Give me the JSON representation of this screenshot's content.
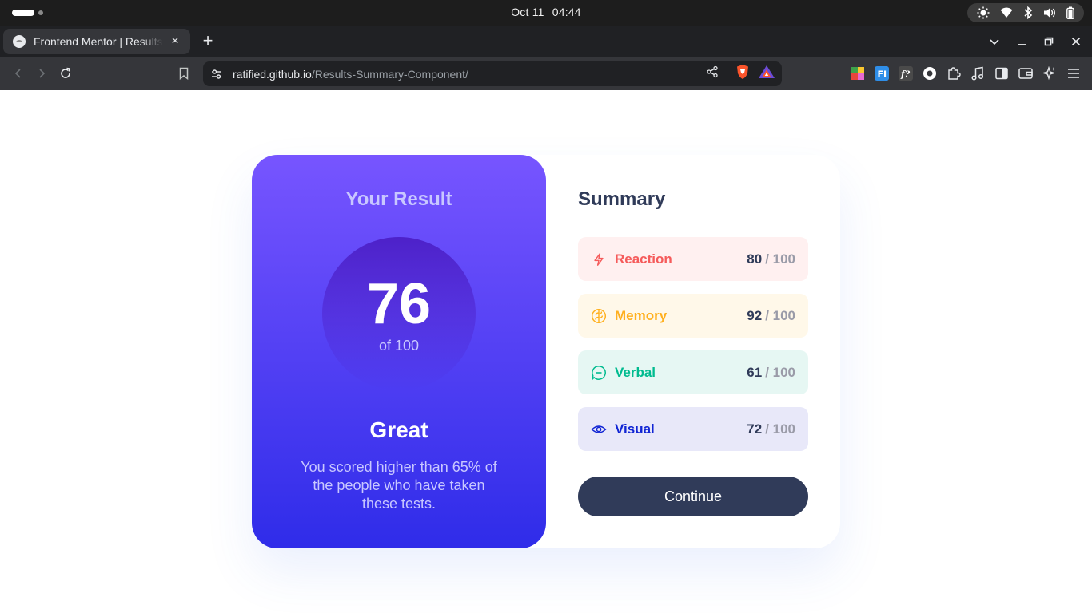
{
  "os": {
    "date": "Oct 11",
    "time": "04:44"
  },
  "browser": {
    "tab_title": "Frontend Mentor | Results summary component",
    "tab_close": "×",
    "new_tab": "+",
    "url_host": "ratified.github.io",
    "url_path": "/Results-Summary-Component/"
  },
  "result": {
    "title": "Your Result",
    "score": "76",
    "score_of": "of 100",
    "grade": "Great",
    "description": "You scored higher than 65% of the people who have taken these tests.",
    "gradient_top": "#7755FF",
    "gradient_bottom": "#2F2CE9"
  },
  "summary": {
    "title": "Summary",
    "items": [
      {
        "label": "Reaction",
        "score": "80",
        "max": "/ 100",
        "icon": "lightning-icon",
        "color": "#F55B5B",
        "bg": "#FFF0F0"
      },
      {
        "label": "Memory",
        "score": "92",
        "max": "/ 100",
        "icon": "brain-icon",
        "color": "#FFB01F",
        "bg": "#FFF8E9"
      },
      {
        "label": "Verbal",
        "score": "61",
        "max": "/ 100",
        "icon": "chat-icon",
        "color": "#00BB8F",
        "bg": "#E6F7F3"
      },
      {
        "label": "Visual",
        "score": "72",
        "max": "/ 100",
        "icon": "eye-icon",
        "color": "#1125D4",
        "bg": "#E8E8F9"
      }
    ],
    "button_label": "Continue",
    "button_color": "#303B59"
  }
}
